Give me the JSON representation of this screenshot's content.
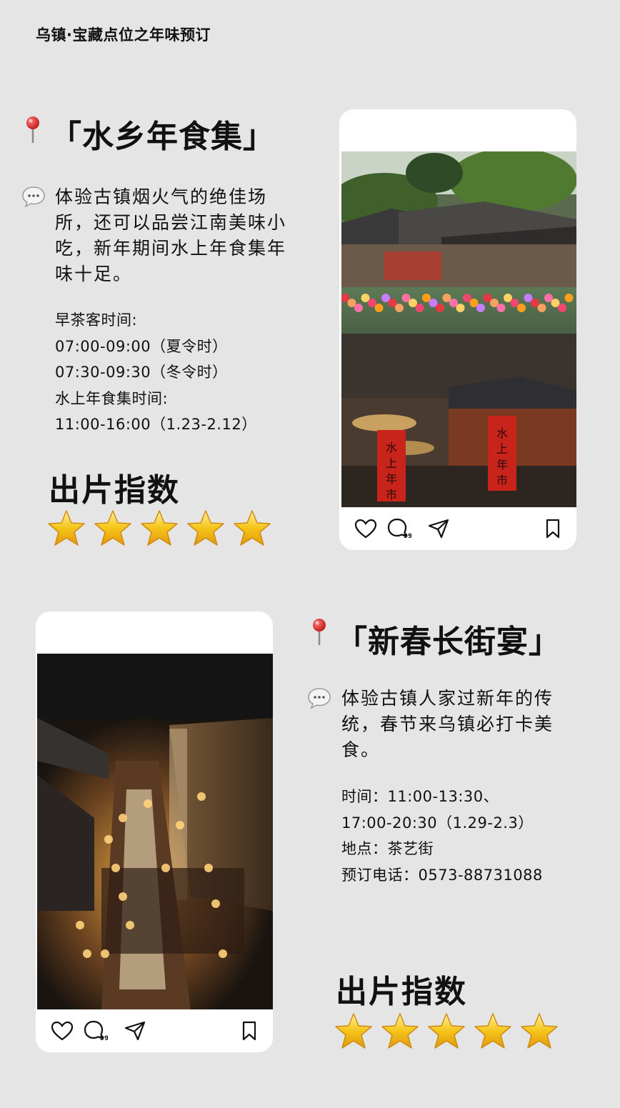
{
  "header": {
    "title": "乌镇·宝藏点位之年味预订"
  },
  "spot1": {
    "title": "「水乡年食集」",
    "description": "体验古镇烟火气的绝佳场所，还可以品尝江南美味小吃，新年期间水上年食集年味十足。",
    "info": [
      "早茶客时间:",
      "07:00-09:00（夏令时）",
      "07:30-09:30（冬令时）",
      "水上年食集时间:",
      "11:00-16:00（1.23-2.12）"
    ],
    "rating_label": "出片指数",
    "rating": 5,
    "photo_signs": [
      "水",
      "上",
      "年",
      "市"
    ],
    "comment_count": "99"
  },
  "spot2": {
    "title": "「新春长街宴」",
    "description": "体验古镇人家过新年的传统，春节来乌镇必打卡美食。",
    "info": [
      "时间：11:00-13:30、",
      "17:00-20:30（1.29-2.3）",
      "地点：茶艺街",
      "预订电话：0573-88731088"
    ],
    "rating_label": "出片指数",
    "rating": 5,
    "comment_count": "99"
  },
  "icons": {
    "pin": "map-pin-icon",
    "bubble": "speech-bubble-icon",
    "star": "star-icon",
    "like": "heart-icon",
    "comment": "comment-icon",
    "share": "send-icon",
    "save": "bookmark-icon"
  },
  "colors": {
    "background": "#e5e5e5",
    "star": "#f5c518",
    "pin": "#d62828"
  }
}
